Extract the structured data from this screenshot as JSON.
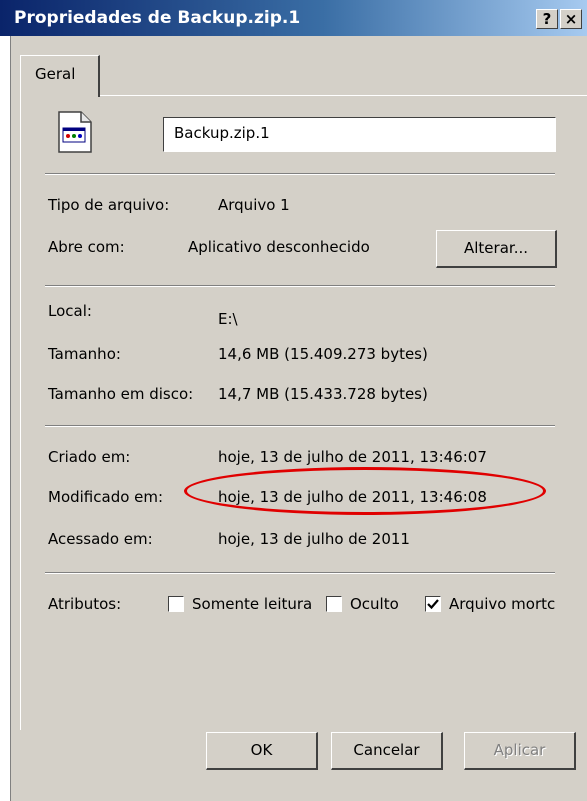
{
  "window": {
    "title": "Propriedades de Backup.zip.1",
    "help_button": "?",
    "close_button": "×"
  },
  "tabs": [
    {
      "label": "Geral"
    }
  ],
  "file": {
    "name": "Backup.zip.1",
    "icon": "unknown-file-icon"
  },
  "fields": {
    "tipo_label": "Tipo de arquivo:",
    "tipo_value": "Arquivo 1",
    "abre_label": "Abre com:",
    "abre_value": "Aplicativo desconhecido",
    "alterar_label": "Alterar...",
    "local_label": "Local:",
    "local_value": "E:\\",
    "tamanho_label": "Tamanho:",
    "tamanho_value": "14,6 MB (15.409.273 bytes)",
    "tamanho_disco_label": "Tamanho em disco:",
    "tamanho_disco_value": "14,7 MB (15.433.728 bytes)",
    "criado_label": "Criado em:",
    "criado_value": "hoje, 13 de julho de 2011, 13:46:07",
    "modificado_label": "Modificado em:",
    "modificado_value": "hoje, 13 de julho de 2011, 13:46:08",
    "acessado_label": "Acessado em:",
    "acessado_value": "hoje, 13 de julho de 2011"
  },
  "attributes": {
    "label": "Atributos:",
    "items": [
      {
        "label": "Somente leitura",
        "checked": false
      },
      {
        "label": "Oculto",
        "checked": false
      },
      {
        "label": "Arquivo mortc",
        "checked": true
      }
    ]
  },
  "buttons": {
    "ok": "OK",
    "cancel": "Cancelar",
    "apply": "Aplicar"
  },
  "colors": {
    "title_bar_start": "#0a246a",
    "title_bar_end": "#a6caf0",
    "window_bg": "#d4d0c8",
    "annotation": "#e00000"
  }
}
